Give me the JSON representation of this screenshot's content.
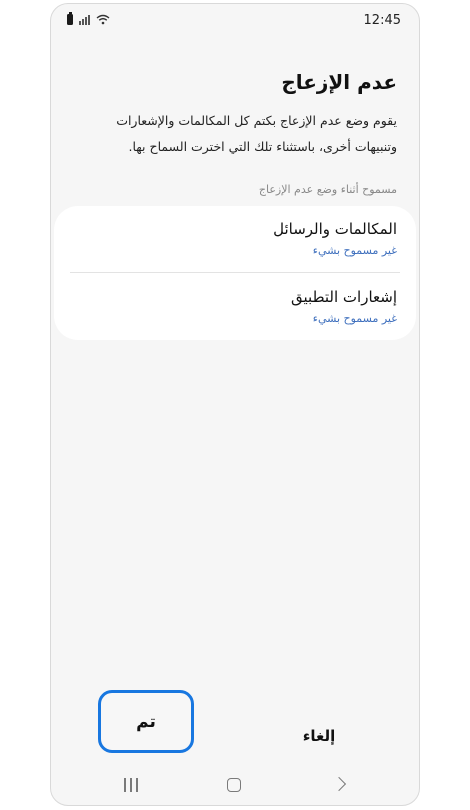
{
  "status_bar": {
    "time": "12:45",
    "icons": [
      "battery-icon",
      "signal-icon",
      "wifi-icon"
    ]
  },
  "page": {
    "title": "عدم الإزعاج",
    "description": "يقوم وضع عدم الإزعاج بكتم كل المكالمات والإشعارات وتنبيهات أخرى، باستثناء تلك التي اخترت السماح بها."
  },
  "section": {
    "header": "مسموح أثناء وضع عدم الإزعاج",
    "items": [
      {
        "title": "المكالمات والرسائل",
        "subtitle": "غير مسموح بشيء"
      },
      {
        "title": "إشعارات التطبيق",
        "subtitle": "غير مسموح بشيء"
      }
    ]
  },
  "buttons": {
    "done": "تم",
    "cancel": "إلغاء"
  },
  "colors": {
    "accent": "#1877e0",
    "subtitle": "#3e6fbd",
    "background": "#f6f6f6",
    "card": "#ffffff"
  },
  "nav_bar": {
    "icons": [
      "recents-icon",
      "home-icon",
      "back-icon"
    ]
  }
}
